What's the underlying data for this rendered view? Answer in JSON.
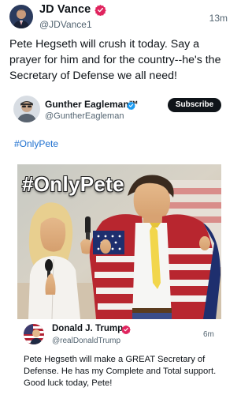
{
  "main_post": {
    "author_name": "JD Vance",
    "author_handle": "@JDVance1",
    "timestamp": "13m",
    "text": "Pete Hegseth will crush it today. Say a prayer for him and for the country--he's the Secretary of Defense we all need!",
    "verified_badge_color": "#e0245e"
  },
  "quoted_post": {
    "author_name": "Gunther Eagleman™",
    "author_handle": "@GuntherEagleman",
    "subscribe_label": "Subscribe",
    "hashtag": "#OnlyPete",
    "verified_badge_color": "#1d9bf0",
    "image": {
      "overlay_text": "#OnlyPete"
    }
  },
  "embedded_post": {
    "author_name": "Donald J. Trump",
    "author_handle": "@realDonaldTrump",
    "timestamp": "6m",
    "text": "Pete Hegseth will make a GREAT Secretary of Defense. He has my Complete and Total support. Good luck today, Pete!",
    "verified_badge_color": "#e0245e"
  },
  "colors": {
    "link": "#1d6fcf",
    "secondary_text": "#536471",
    "primary_text": "#0f1419"
  }
}
